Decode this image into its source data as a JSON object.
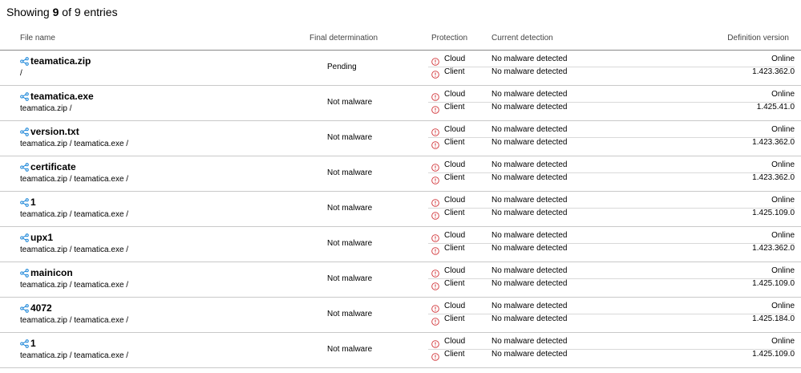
{
  "summary": {
    "prefix": "Showing ",
    "shown": "9",
    "middle": " of ",
    "total": "9",
    "suffix": " entries"
  },
  "columns": {
    "file_name": "File name",
    "final_determination": "Final determination",
    "protection": "Protection",
    "current_detection": "Current detection",
    "definition_version": "Definition version"
  },
  "colors": {
    "alert": "#d13438",
    "link_icon": "#0078d4",
    "row_border": "#c9c9c9",
    "header_border": "#8a8a8a"
  },
  "icons": {
    "file": "share-icon",
    "status": "alert-circle-icon"
  },
  "rows": [
    {
      "name": "teamatica.zip",
      "path": "/",
      "final": "Pending",
      "cloud": {
        "protection": "Cloud",
        "detection": "No malware detected",
        "definition": "Online"
      },
      "client": {
        "protection": "Client",
        "detection": "No malware detected",
        "definition": "1.423.362.0"
      }
    },
    {
      "name": "teamatica.exe",
      "path": "teamatica.zip /",
      "final": "Not malware",
      "cloud": {
        "protection": "Cloud",
        "detection": "No malware detected",
        "definition": "Online"
      },
      "client": {
        "protection": "Client",
        "detection": "No malware detected",
        "definition": "1.425.41.0"
      }
    },
    {
      "name": "version.txt",
      "path": "teamatica.zip / teamatica.exe /",
      "final": "Not malware",
      "cloud": {
        "protection": "Cloud",
        "detection": "No malware detected",
        "definition": "Online"
      },
      "client": {
        "protection": "Client",
        "detection": "No malware detected",
        "definition": "1.423.362.0"
      }
    },
    {
      "name": "certificate",
      "path": "teamatica.zip / teamatica.exe /",
      "final": "Not malware",
      "cloud": {
        "protection": "Cloud",
        "detection": "No malware detected",
        "definition": "Online"
      },
      "client": {
        "protection": "Client",
        "detection": "No malware detected",
        "definition": "1.423.362.0"
      }
    },
    {
      "name": "1",
      "path": "teamatica.zip / teamatica.exe /",
      "final": "Not malware",
      "cloud": {
        "protection": "Cloud",
        "detection": "No malware detected",
        "definition": "Online"
      },
      "client": {
        "protection": "Client",
        "detection": "No malware detected",
        "definition": "1.425.109.0"
      }
    },
    {
      "name": "upx1",
      "path": "teamatica.zip / teamatica.exe /",
      "final": "Not malware",
      "cloud": {
        "protection": "Cloud",
        "detection": "No malware detected",
        "definition": "Online"
      },
      "client": {
        "protection": "Client",
        "detection": "No malware detected",
        "definition": "1.423.362.0"
      }
    },
    {
      "name": "mainicon",
      "path": "teamatica.zip / teamatica.exe /",
      "final": "Not malware",
      "cloud": {
        "protection": "Cloud",
        "detection": "No malware detected",
        "definition": "Online"
      },
      "client": {
        "protection": "Client",
        "detection": "No malware detected",
        "definition": "1.425.109.0"
      }
    },
    {
      "name": "4072",
      "path": "teamatica.zip / teamatica.exe /",
      "final": "Not malware",
      "cloud": {
        "protection": "Cloud",
        "detection": "No malware detected",
        "definition": "Online"
      },
      "client": {
        "protection": "Client",
        "detection": "No malware detected",
        "definition": "1.425.184.0"
      }
    },
    {
      "name": "1",
      "path": "teamatica.zip / teamatica.exe /",
      "final": "Not malware",
      "cloud": {
        "protection": "Cloud",
        "detection": "No malware detected",
        "definition": "Online"
      },
      "client": {
        "protection": "Client",
        "detection": "No malware detected",
        "definition": "1.425.109.0"
      }
    }
  ]
}
